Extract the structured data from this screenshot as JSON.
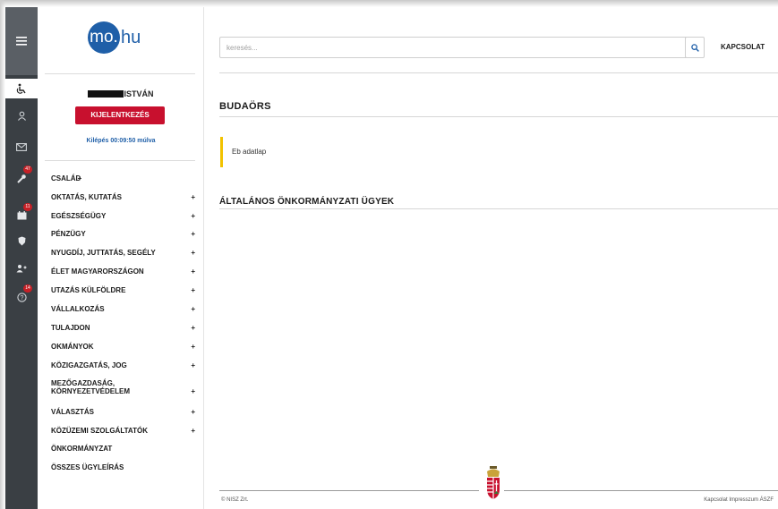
{
  "logo": {
    "part1": "mo.",
    "part2": "hu"
  },
  "user": {
    "name_suffix": "ISTVÁN"
  },
  "logout": {
    "label": "KIJELENTKEZÉS"
  },
  "session": {
    "timer_text": "Kilépés 00:09:50 múlva"
  },
  "rail": {
    "icons": [
      "menu-icon",
      "wheelchair-icon",
      "user-icon",
      "mail-icon",
      "wrench-icon",
      "calendar-icon",
      "shield-icon",
      "users-icon",
      "help-icon"
    ],
    "badges": {
      "wrench": "47",
      "calendar": "11",
      "help": "14"
    }
  },
  "menu": {
    "items": [
      {
        "label": "CSALÁD",
        "expandable": true
      },
      {
        "label": "OKTATÁS, KUTATÁS",
        "expandable": true
      },
      {
        "label": "EGÉSZSÉGÜGY",
        "expandable": true
      },
      {
        "label": "PÉNZÜGY",
        "expandable": true
      },
      {
        "label": "NYUGDÍJ, JUTTATÁS, SEGÉLY",
        "expandable": true
      },
      {
        "label": "ÉLET MAGYARORSZÁGON",
        "expandable": true
      },
      {
        "label": "UTAZÁS KÜLFÖLDRE",
        "expandable": true
      },
      {
        "label": "VÁLLALKOZÁS",
        "expandable": true
      },
      {
        "label": "TULAJDON",
        "expandable": true
      },
      {
        "label": "OKMÁNYOK",
        "expandable": true
      },
      {
        "label": "KÖZIGAZGATÁS, JOG",
        "expandable": true
      },
      {
        "label": "MEZŐGAZDASÁG,",
        "label2": "KÖRNYEZETVÉDELEM",
        "expandable": true
      },
      {
        "label": "VÁLASZTÁS",
        "expandable": true
      },
      {
        "label": "KÖZÜZEMI SZOLGÁLTATÓK",
        "expandable": true
      },
      {
        "label": "ÖNKORMÁNYZAT",
        "expandable": false
      },
      {
        "label": "ÖSSZES ÜGYLEÍRÁS",
        "expandable": false
      }
    ],
    "plus_symbol": "+"
  },
  "search": {
    "placeholder": "keresés..."
  },
  "header": {
    "contact_label": "KAPCSOLAT"
  },
  "content": {
    "city_heading": "BUDAÖRS",
    "notice_text": "Eb adatlap",
    "section_heading": "ÁLTALÁNOS ÖNKORMÁNYZATI ÜGYEK"
  },
  "footer": {
    "copyright": "© NISZ Zrt.",
    "links": "Kapcsolat Impresszum ÁSZF"
  },
  "colors": {
    "brand_blue": "#1f5fa8",
    "logout_red": "#c8102e",
    "notice_yellow": "#f2c200",
    "rail_dark": "#3a3f44"
  }
}
